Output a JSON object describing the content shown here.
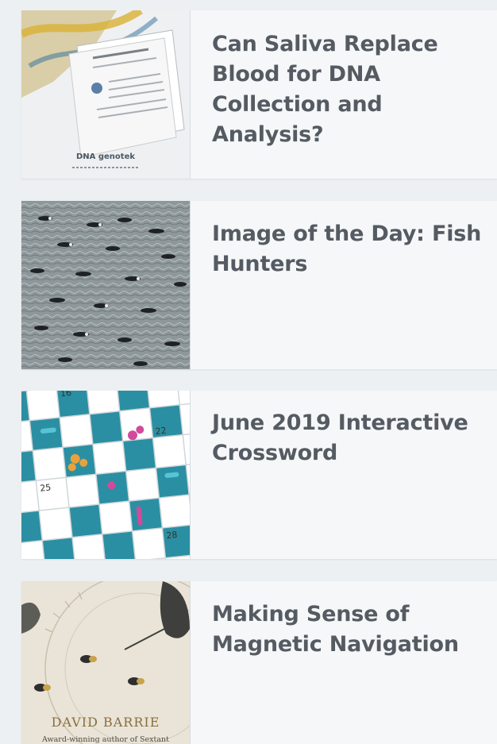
{
  "articles": [
    {
      "title_line1": "Can Saliva Replace",
      "title_line2": "Blood for DNA",
      "title_line3": "Collection and Analysis?",
      "thumb_icon": "dna-genotek-report-image",
      "thumb_brand": "DNA genotek"
    },
    {
      "title_line1": "Image of the Day: Fish",
      "title_line2": "Hunters",
      "thumb_icon": "penguins-swimming-image"
    },
    {
      "title_line1": "June 2019 Interactive",
      "title_line2": "Crossword",
      "thumb_icon": "crossword-grid-image",
      "thumb_numbers": [
        "16",
        "22",
        "25",
        "28"
      ]
    },
    {
      "title_line1": "Making Sense of",
      "title_line2": "Magnetic Navigation",
      "thumb_icon": "book-cover-image",
      "thumb_author": "DAVID BARRIE",
      "thumb_tagline": "Award-winning author of Sextant"
    }
  ],
  "colors": {
    "page_bg": "#edf0f3",
    "card_bg": "#f6f7f9",
    "title_text": "#555b62"
  }
}
